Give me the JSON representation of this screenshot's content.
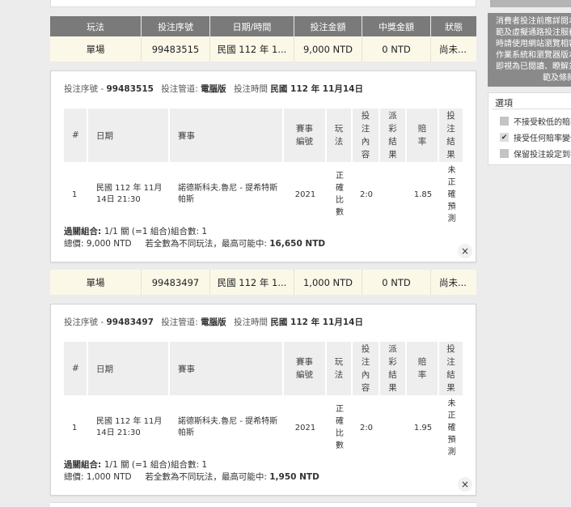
{
  "table_header": [
    "玩法",
    "投注序號",
    "日期/時間",
    "投注金額",
    "中獎金額",
    "狀態"
  ],
  "bets": [
    {
      "row": {
        "play": "單場",
        "serial": "99483515",
        "datetime": "民國 112 年 1...",
        "amount": "9,000 NTD",
        "prize": "0 NTD",
        "status": "尚未..."
      },
      "detail": {
        "serial_label": "投注序號 -",
        "serial": "99483515",
        "channel_label": "投注管道:",
        "channel": "電腦版",
        "time_label": "投注時間",
        "time": "民國 112 年 11月14日",
        "headers": {
          "num": "#",
          "date": "日期",
          "match": "賽事",
          "match_no": [
            "賽事",
            "編號"
          ],
          "play": [
            "玩",
            "法"
          ],
          "content": [
            "投",
            "注",
            "內",
            "容"
          ],
          "payout": [
            "派",
            "彩",
            "結",
            "果"
          ],
          "odds": [
            "賠",
            "率"
          ],
          "result": [
            "投",
            "注",
            "結",
            "果"
          ]
        },
        "line": {
          "num": "1",
          "date": [
            "民國 112 年 11月",
            "14日 21:30"
          ],
          "match": [
            "諾德斯科夫.魯尼 - 提希特斯",
            "帕斯"
          ],
          "match_no": "2021",
          "play": [
            "正",
            "確",
            "比",
            "數"
          ],
          "content": "2:0",
          "payout": "",
          "odds": "1.85",
          "result": [
            "未",
            "正",
            "確",
            "預",
            "測"
          ]
        },
        "combo_label": "過關組合:",
        "combo": "1/1 關 (=1 組合)組合數: 1",
        "total_label": "總價:",
        "total": "9,000 NTD",
        "max_label": "若全數為不同玩法，最高可能中:",
        "max": "16,650 NTD",
        "close": "×"
      }
    },
    {
      "row": {
        "play": "單場",
        "serial": "99483497",
        "datetime": "民國 112 年 1...",
        "amount": "1,000 NTD",
        "prize": "0 NTD",
        "status": "尚未..."
      },
      "detail": {
        "serial_label": "投注序號 -",
        "serial": "99483497",
        "channel_label": "投注管道:",
        "channel": "電腦版",
        "time_label": "投注時間",
        "time": "民國 112 年 11月14日",
        "headers": {
          "num": "#",
          "date": "日期",
          "match": "賽事",
          "match_no": [
            "賽事",
            "編號"
          ],
          "play": [
            "玩",
            "法"
          ],
          "content": [
            "投",
            "注",
            "內",
            "容"
          ],
          "payout": [
            "派",
            "彩",
            "結",
            "果"
          ],
          "odds": [
            "賠",
            "率"
          ],
          "result": [
            "投",
            "注",
            "結",
            "果"
          ]
        },
        "line": {
          "num": "1",
          "date": [
            "民國 112 年 11月",
            "14日 21:30"
          ],
          "match": [
            "諾德斯科夫.魯尼 - 提希特斯",
            "帕斯"
          ],
          "match_no": "2021",
          "play": [
            "正",
            "確",
            "比",
            "數"
          ],
          "content": "2:0",
          "payout": "",
          "odds": "1.95",
          "result": [
            "未",
            "正",
            "確",
            "預",
            "測"
          ]
        },
        "combo_label": "過關組合:",
        "combo": "1/1 關 (=1 組合)組合數: 1",
        "total_label": "總價:",
        "total": "1,000 NTD",
        "max_label": "若全數為不同玩法，最高可能中:",
        "max": "1,950 NTD",
        "close": "×"
      }
    }
  ],
  "side_panel": {
    "notice_lines": [
      "消費者投注前應詳閱本",
      "範及虛擬通路投注服務",
      "時請使用網站瀏覽相容",
      "作業系統和瀏覽器版本",
      "即視為已閱讀、瞭解並",
      "範及條款"
    ],
    "options_title": "選項",
    "options": [
      {
        "label": "不接受較低的賠率",
        "checked": false
      },
      {
        "label": "接受任何賠率變化",
        "checked": true
      },
      {
        "label": "保留投注設定到我",
        "checked": false
      }
    ],
    "checkmark": "✔"
  }
}
